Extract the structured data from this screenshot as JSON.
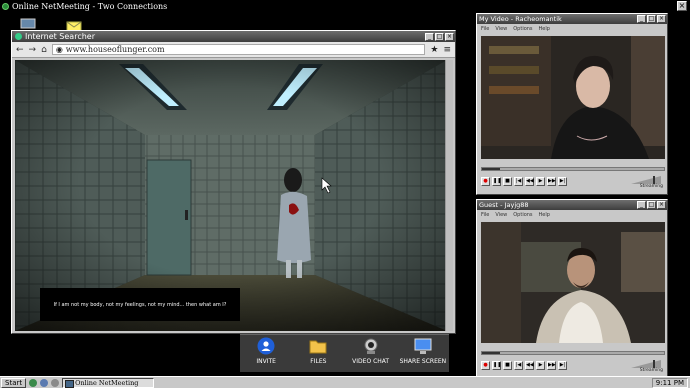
{
  "desktop": {
    "title": "Online NetMeeting - Two Connections",
    "close_label": "×"
  },
  "browser": {
    "title": "Internet Searcher",
    "url": "www.houseoflunger.com",
    "back_glyph": "←",
    "forward_glyph": "→",
    "home_glyph": "⌂",
    "star_glyph": "★",
    "menu_glyph": "≡",
    "subtitle": "If I am not my body, not my feelings, not my mind... then what am I?"
  },
  "apps": [
    {
      "label": "INVITE",
      "icon": "invite-icon"
    },
    {
      "label": "FILES",
      "icon": "files-folder-icon"
    },
    {
      "label": "VIDEO CHAT",
      "icon": "webcam-icon"
    },
    {
      "label": "SHARE SCREEN",
      "icon": "monitor-icon"
    }
  ],
  "video_self": {
    "title": "My Video - Racheomantik",
    "menu": [
      "File",
      "View",
      "Options",
      "Help"
    ],
    "status": "Streaming"
  },
  "video_guest": {
    "title": "Guest - Jayjg88",
    "menu": [
      "File",
      "View",
      "Options",
      "Help"
    ],
    "status": "Streaming"
  },
  "taskbar": {
    "start_label": "Start",
    "task_label": "Online NetMeeting",
    "clock": "9:11 PM"
  }
}
